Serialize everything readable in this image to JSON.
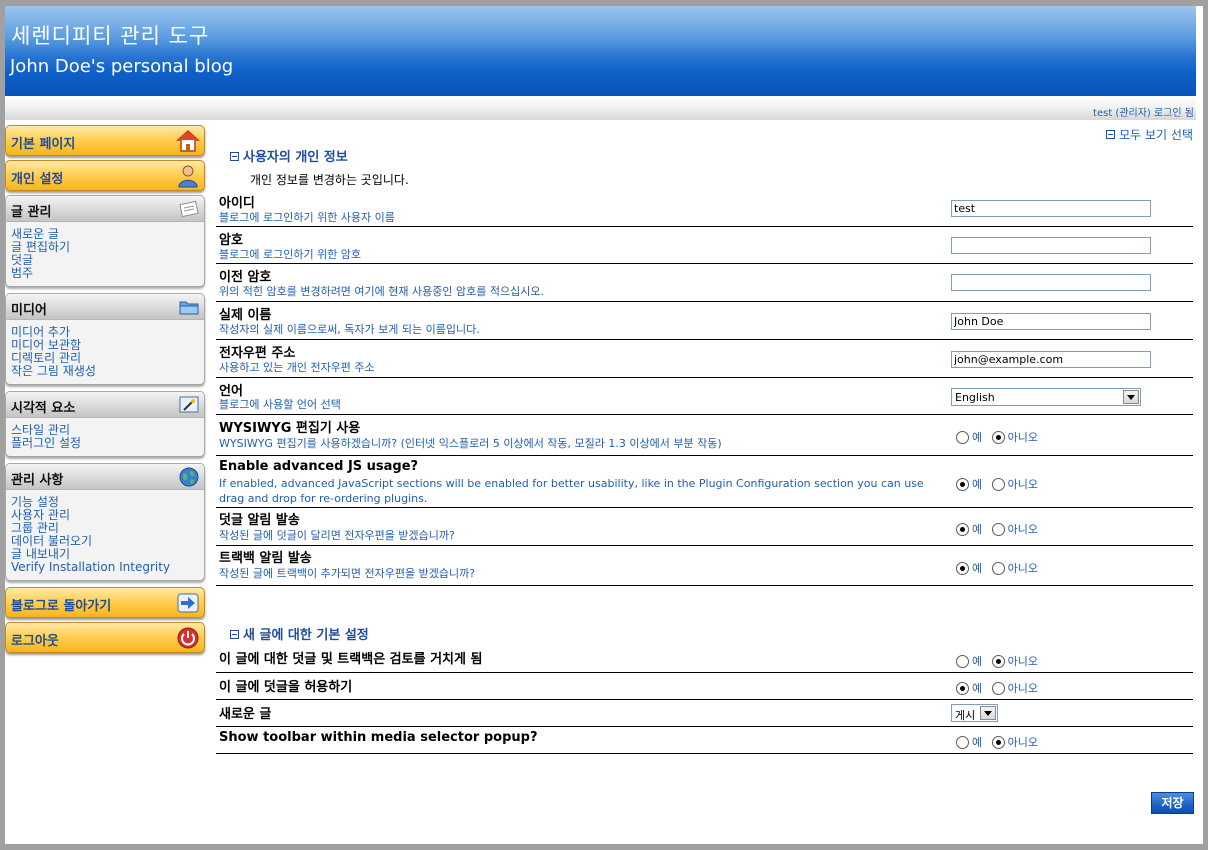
{
  "header": {
    "title": "세렌디피티 관리 도구",
    "blog_name": "John Doe's personal blog",
    "user_status": "test (관리자) 로그인 됨"
  },
  "sidebar": {
    "home": "기본 페이지",
    "personal": "개인 설정",
    "entries": {
      "title": "글 관리",
      "items": [
        "새로운 글",
        "글 편집하기",
        "덧글",
        "범주"
      ]
    },
    "media": {
      "title": "미디어",
      "items": [
        "미디어 추가",
        "미디어 보관함",
        "디렉토리 관리",
        "작은 그림 재생성"
      ]
    },
    "visual": {
      "title": "시각적 요소",
      "items": [
        "스타일 관리",
        "플러그인 설정"
      ]
    },
    "admin": {
      "title": "관리 사항",
      "items": [
        "기능 설정",
        "사용자 관리",
        "그룹 관리",
        "데이터 불러오기",
        "글 내보내기",
        "Verify Installation Integrity"
      ]
    },
    "back_to_blog": "블로그로 돌아가기",
    "logout": "로그아웃"
  },
  "main": {
    "view_all": "모두 보기 선택",
    "section1_title": "사용자의 개인 정보",
    "intro": "개인 정보를 변경하는 곳입니다.",
    "fields": {
      "username": {
        "name": "아이디",
        "desc": "블로그에 로그인하기 위한 사용자 이름",
        "value": "test"
      },
      "password": {
        "name": "암호",
        "desc": "블로그에 로그인하기 위한 암호",
        "value": ""
      },
      "old_password": {
        "name": "이전 암호",
        "desc": "위의 적힌 암호를 변경하려면 여기에 현재 사용중인 암호를 적으십시오.",
        "value": ""
      },
      "realname": {
        "name": "실제 이름",
        "desc": "작성자의 실제 이름으로써, 독자가 보게 되는 이름입니다.",
        "value": "John Doe"
      },
      "email": {
        "name": "전자우편 주소",
        "desc": "사용하고 있는 개인 전자우편 주소",
        "value": "john@example.com"
      },
      "language": {
        "name": "언어",
        "desc": "블로그에 사용할 언어 선택",
        "value": "English"
      },
      "wysiwyg": {
        "name": "WYSIWYG 편집기 사용",
        "desc": "WYSIWYG 편집기를 사용하겠습니까? (인터넷 익스플로러 5 이상에서 작동, 모질라 1.3 이상에서 부분 작동)",
        "selected": "no"
      },
      "advanced_js": {
        "name": "Enable advanced JS usage?",
        "desc": "If enabled, advanced JavaScript sections will be enabled for better usability, like in the Plugin Configuration section you can use drag and drop for re-ordering plugins.",
        "selected": "yes"
      },
      "comment_mail": {
        "name": "덧글 알림 발송",
        "desc": "작성된 글에 덧글이 달리면 전자우편을 받겠습니까?",
        "selected": "yes"
      },
      "trackback_mail": {
        "name": "트랙백 알림 발송",
        "desc": "작성된 글에 트랙백이 추가되면 전자우편을 받겠습니까?",
        "selected": "yes"
      }
    },
    "section2_title": "새 글에 대한 기본 설정",
    "defaults": {
      "moderate": {
        "name": "이 글에 대한 덧글 및 트랙백은 검토를 거치게 됨",
        "selected": "no"
      },
      "allow_comments": {
        "name": "이 글에 덧글을 허용하기",
        "selected": "yes"
      },
      "new_entry": {
        "name": "새로운 글",
        "value": "게시"
      },
      "media_toolbar": {
        "name": "Show toolbar within media selector popup?",
        "selected": "no"
      }
    },
    "yes_label": "예",
    "no_label": "아니오",
    "save_label": "저장"
  }
}
